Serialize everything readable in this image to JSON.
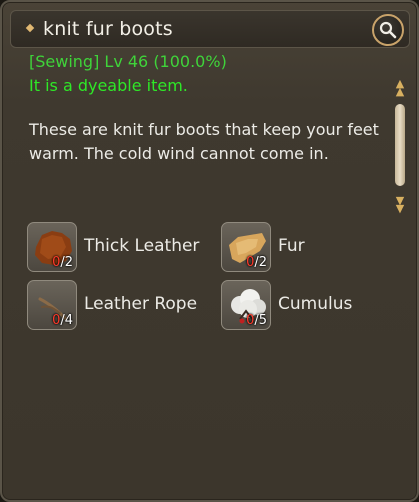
{
  "window": {
    "title": "knit fur boots",
    "magnify_icon": "magnifier-icon"
  },
  "info": {
    "craft_line": "[Sewing] Lv 46 (100.0%)",
    "dyeable_line": "It is a dyeable item.",
    "description": "These are knit fur boots that keep your feet warm. The cold wind cannot come in."
  },
  "materials": [
    {
      "name": "Thick Leather",
      "have": "0",
      "need": "/2",
      "icon": "thick-leather-icon"
    },
    {
      "name": "Fur",
      "have": "0",
      "need": "/2",
      "icon": "fur-icon"
    },
    {
      "name": "Leather Rope",
      "have": "0",
      "need": "/4",
      "icon": "leather-rope-icon"
    },
    {
      "name": "Cumulus",
      "have": "0",
      "need": "/5",
      "icon": "cumulus-icon"
    }
  ],
  "colors": {
    "title": "#f2efe6",
    "green_text": "#3fd33a",
    "count_missing": "#ff3a2a",
    "accent_gold": "#c9a36a"
  }
}
